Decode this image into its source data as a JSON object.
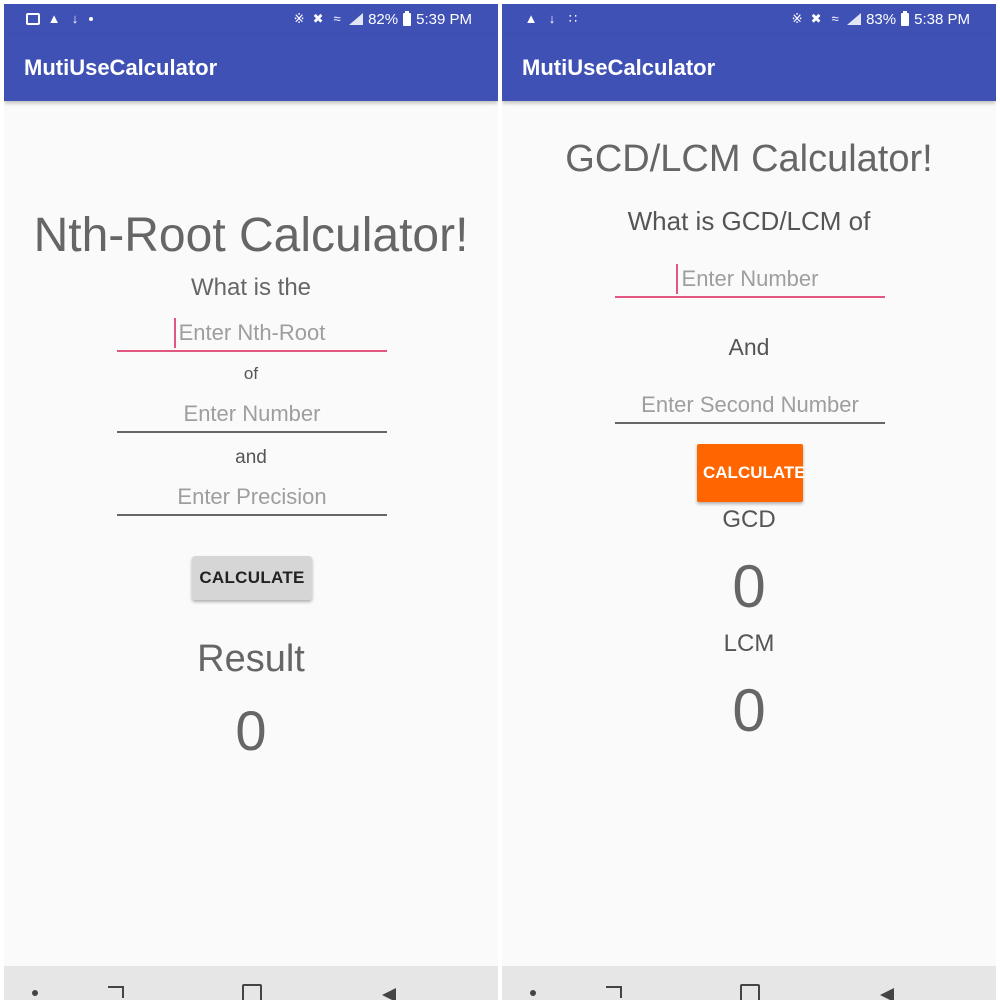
{
  "left": {
    "status": {
      "battery": "82%",
      "time": "5:39 PM"
    },
    "app_title": "MutiUseCalculator",
    "heading": "Nth-Root Calculator!",
    "prompt": "What is the",
    "root_input": {
      "value": "",
      "placeholder": "Enter Nth-Root"
    },
    "of_label": "of",
    "number_input": {
      "value": "",
      "placeholder": "Enter Number"
    },
    "and_label": "and",
    "precision_input": {
      "value": "",
      "placeholder": "Enter Precision"
    },
    "calculate_label": "CALCULATE",
    "result_label": "Result",
    "result_value": "0"
  },
  "right": {
    "status": {
      "battery": "83%",
      "time": "5:38 PM"
    },
    "app_title": "MutiUseCalculator",
    "heading": "GCD/LCM Calculator!",
    "prompt": "What is GCD/LCM of",
    "first_input": {
      "value": "",
      "placeholder": "Enter Number"
    },
    "and_label": "And",
    "second_input": {
      "value": "",
      "placeholder": "Enter Second Number"
    },
    "calculate_label": "CALCULATE",
    "gcd_label": "GCD",
    "gcd_value": "0",
    "lcm_label": "LCM",
    "lcm_value": "0"
  },
  "colors": {
    "primary": "#3f51b5",
    "accent": "#e2577f",
    "orange_button": "#ff6600",
    "gray_button": "#d6d6d6"
  },
  "icons": [
    "image-icon",
    "snapchat-icon",
    "download-icon",
    "dot-icon",
    "grid-icon",
    "bluetooth-icon",
    "mute-icon",
    "wifi-icon",
    "signal-icon",
    "battery-icon",
    "nav-dot-icon",
    "recent-apps-icon",
    "home-icon",
    "back-icon"
  ]
}
